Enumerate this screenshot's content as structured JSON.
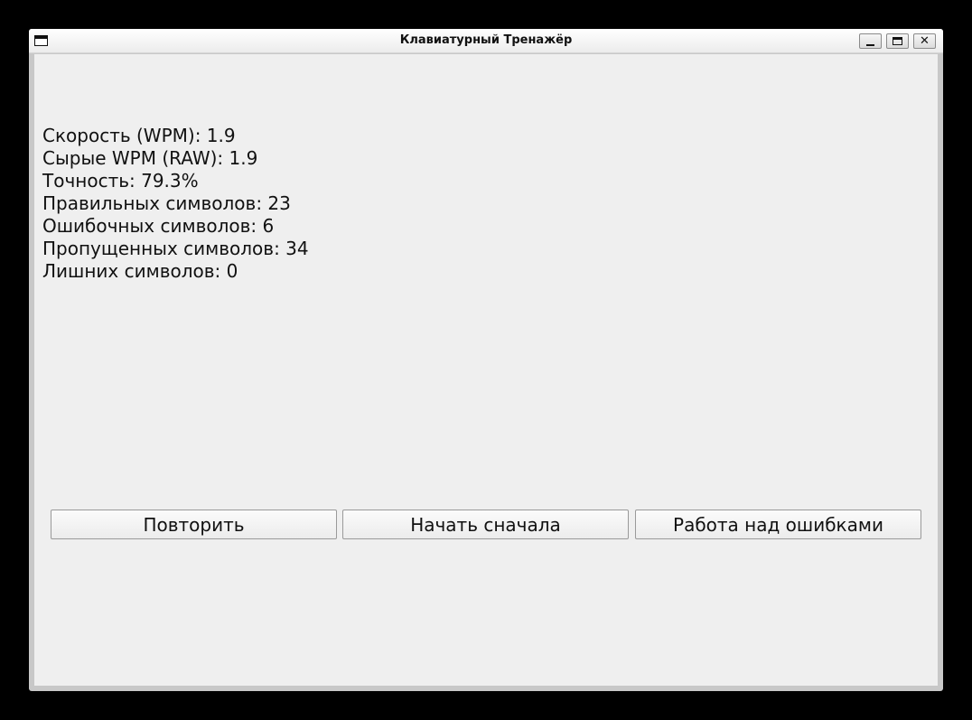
{
  "window": {
    "title": "Клавиатурный Тренажёр"
  },
  "stats": [
    {
      "label": "Скорость (WPM): 1.9"
    },
    {
      "label": "Сырые WPM (RAW): 1.9"
    },
    {
      "label": "Точность: 79.3%"
    },
    {
      "label": "Правильных символов: 23"
    },
    {
      "label": "Ошибочных символов: 6"
    },
    {
      "label": "Пропущенных символов: 34"
    },
    {
      "label": "Лишних символов: 0"
    }
  ],
  "buttons": {
    "repeat": "Повторить",
    "restart": "Начать сначала",
    "mistakes": "Работа над ошибками"
  },
  "icons": {
    "window": "window-icon",
    "minimize": "minimize-icon",
    "maximize": "maximize-icon",
    "close": "close-icon"
  }
}
